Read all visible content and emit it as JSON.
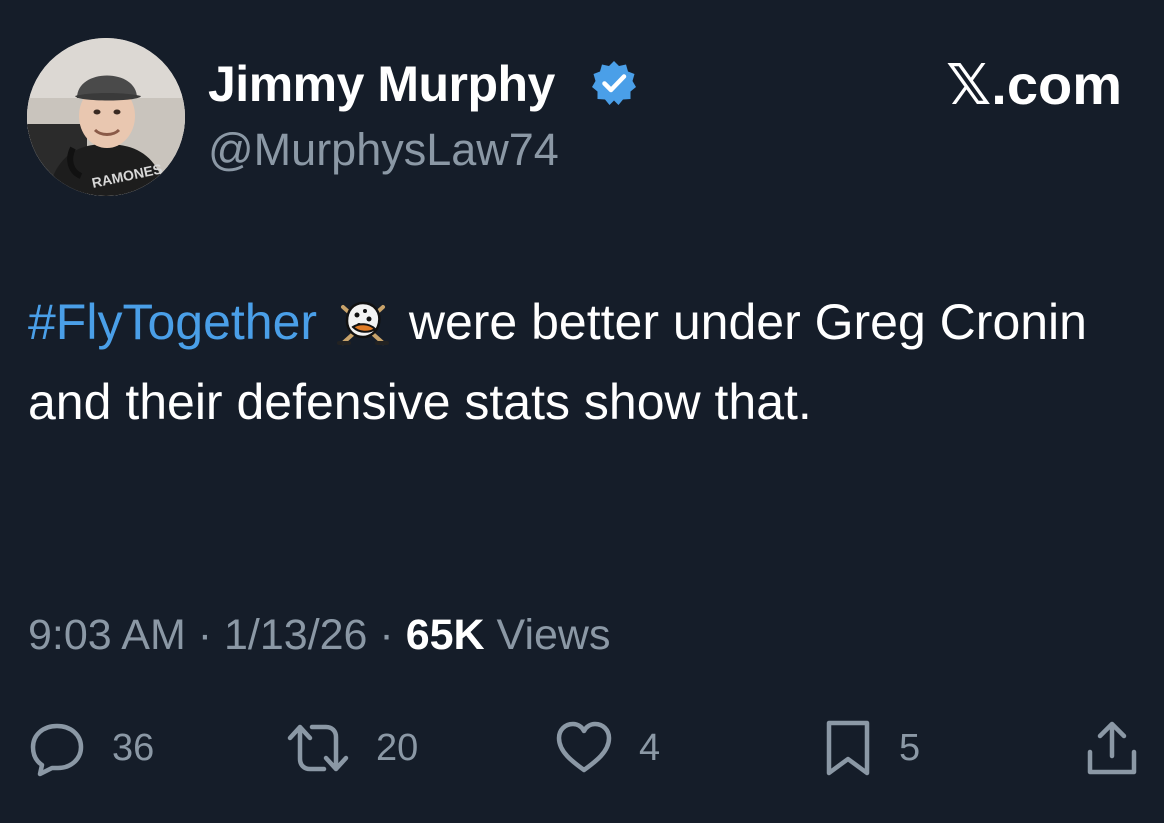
{
  "author": {
    "display_name": "Jimmy Murphy",
    "handle": "@MurphysLaw74",
    "verified": true,
    "avatar_shirt_text": "RAMONES"
  },
  "brand": "𝕏.com",
  "tweet": {
    "hashtag": "#FlyTogether",
    "text_after_hashtag": " were better under Greg Cronin and their defensive stats show that.",
    "emoji": "duck-logo-icon"
  },
  "meta": {
    "time": "9:03 AM",
    "separator": "·",
    "date": "1/13/26",
    "views_count": "65K",
    "views_label": "Views"
  },
  "actions": {
    "replies": "36",
    "reposts": "20",
    "likes": "4",
    "bookmarks": "5"
  },
  "colors": {
    "background": "#151d29",
    "text": "#ffffff",
    "secondary": "#8b98a5",
    "link": "#4a9fe8",
    "verified": "#4a9fe8"
  }
}
